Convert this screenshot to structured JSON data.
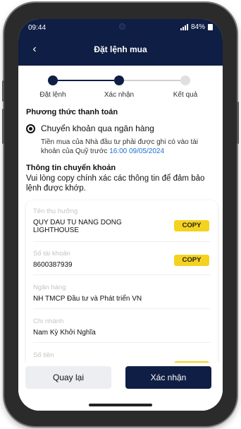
{
  "status_bar": {
    "time": "09:44",
    "battery": "84%"
  },
  "header": {
    "title": "Đặt lệnh mua"
  },
  "stepper": {
    "steps": [
      {
        "label": "Đặt lệnh"
      },
      {
        "label": "Xác nhận"
      },
      {
        "label": "Kết quả"
      }
    ]
  },
  "payment": {
    "section_title": "Phương thức thanh toán",
    "option_label": "Chuyển khoản qua ngân hàng",
    "note_text": "Tiền mua của Nhà đầu tư phải được ghi có vào tài khoản của Quỹ trước ",
    "deadline": "16:00 09/05/2024"
  },
  "transfer": {
    "section_title": "Thông tin chuyển khoản",
    "description": "Vui lòng copy chính xác các thông tin để đảm bảo lệnh được khớp.",
    "copy_label": "COPY",
    "fields": [
      {
        "label": "Tên thụ hưởng",
        "value": "QUY DAU TU NANG DONG LIGHTHOUSE"
      },
      {
        "label": "Số tài khoản",
        "value": "8600387939"
      },
      {
        "label": "Ngân hàng",
        "value": "NH TMCP Đầu tư và Phát triển VN"
      },
      {
        "label": "Chi nhánh",
        "value": "Nam Kỳ Khởi Nghĩa"
      },
      {
        "label": "Số tiền",
        "value": ""
      }
    ]
  },
  "actions": {
    "back_label": "Quay lại",
    "confirm_label": "Xác nhận"
  },
  "colors": {
    "primary": "#0f1e44",
    "copy_button": "#f5d21f",
    "link": "#1a6fd6",
    "step_pending": "#e0e0e0"
  }
}
